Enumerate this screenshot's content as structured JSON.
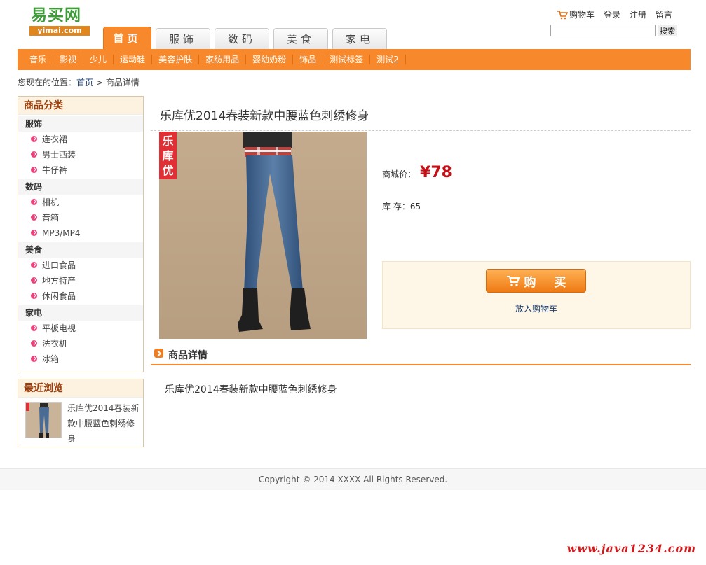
{
  "header": {
    "logo_text": "易买网",
    "logo_sub": "yimai.com",
    "top_links": {
      "cart": "购物车",
      "login": "登录",
      "register": "注册",
      "message": "留言"
    },
    "search": {
      "value": "",
      "button_label": "搜索"
    }
  },
  "main_tabs": [
    {
      "label": "首页",
      "active": true
    },
    {
      "label": "服饰",
      "active": false
    },
    {
      "label": "数码",
      "active": false
    },
    {
      "label": "美食",
      "active": false
    },
    {
      "label": "家电",
      "active": false
    }
  ],
  "sub_nav": [
    "音乐",
    "影视",
    "少儿",
    "运动鞋",
    "美容护肤",
    "家纺用品",
    "婴幼奶粉",
    "饰品",
    "测试标签",
    "测试2"
  ],
  "breadcrumb": {
    "prefix": "您现在的位置：",
    "home": "首页",
    "separator": ">",
    "current": "商品详情"
  },
  "sidebar": {
    "category_title": "商品分类",
    "groups": [
      {
        "title": "服饰",
        "items": [
          "连衣裙",
          "男士西装",
          "牛仔裤"
        ]
      },
      {
        "title": "数码",
        "items": [
          "相机",
          "音箱",
          "MP3/MP4"
        ]
      },
      {
        "title": "美食",
        "items": [
          "进口食品",
          "地方特产",
          "休闲食品"
        ]
      },
      {
        "title": "家电",
        "items": [
          "平板电视",
          "洗衣机",
          "冰箱"
        ]
      }
    ],
    "recent_title": "最近浏览",
    "recent_item": "乐库优2014春装新款中腰蓝色刺绣修身"
  },
  "product": {
    "title": "乐库优2014春装新款中腰蓝色刺绣修身",
    "brand_badge": "乐库优",
    "price_label": "商城价：",
    "price": "¥78",
    "stock_label": "库 存：",
    "stock": "65",
    "buy_label": "购 买",
    "add_cart_label": "放入购物车",
    "detail_title": "商品详情",
    "detail_text": "乐库优2014春装新款中腰蓝色刺绣修身"
  },
  "footer": {
    "copyright": "Copyright © 2014 XXXX All Rights Reserved."
  },
  "watermark": "www.java1234.com",
  "colors": {
    "accent_orange": "#f7892c",
    "price_red": "#c51018",
    "link_blue": "#1c3e70",
    "logo_green": "#3f9a3a"
  }
}
